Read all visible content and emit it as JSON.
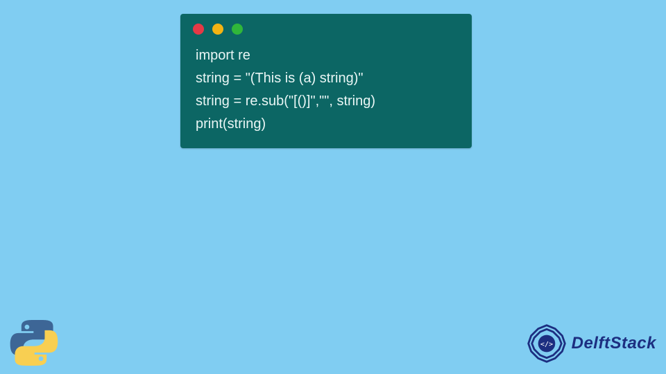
{
  "colors": {
    "background": "#80cdf2",
    "card": "#0c6664",
    "codeText": "#e9f6f5",
    "brand": "#1c2e80",
    "dots": {
      "red": "#e63946",
      "yellow": "#f4b313",
      "green": "#30b63a"
    }
  },
  "code": {
    "lines": [
      "import re",
      "string = \"(This is (a) string)\"",
      "string = re.sub(\"[()]\",\"\", string)",
      "print(string)"
    ]
  },
  "brand": {
    "name": "DelftStack",
    "icon": "delftstack-logo"
  },
  "pythonLogo": {
    "icon": "python-logo"
  }
}
